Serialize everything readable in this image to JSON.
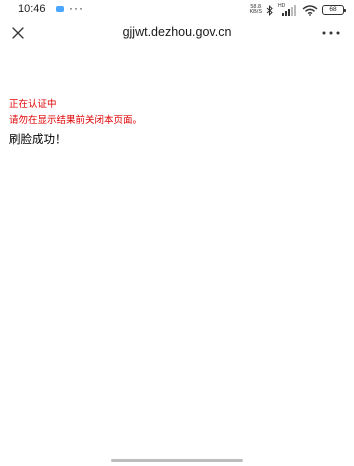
{
  "status_bar": {
    "time": "10:46",
    "more": "···",
    "netspeed_value": "58.8",
    "netspeed_unit": "KB/S",
    "signal_label": "HD",
    "battery": "68",
    "icons": [
      "bluetooth-icon",
      "signal-icon",
      "wifi-icon",
      "battery-icon"
    ]
  },
  "nav": {
    "title": "gjjwt.dezhou.gov.cn",
    "icons": [
      "close-icon",
      "more-icon"
    ]
  },
  "content": {
    "line1": "正在认证中",
    "line2": "请勿在显示结果前关闭本页面。",
    "line3": "刷脸成功！"
  },
  "colors": {
    "warning_text": "#e00000",
    "body_text": "#000000"
  }
}
